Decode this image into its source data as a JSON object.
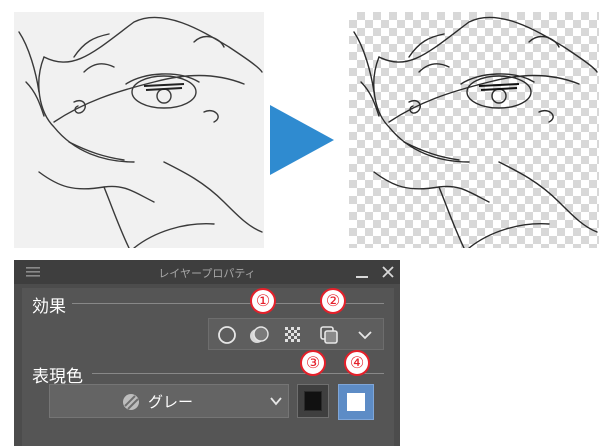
{
  "panel": {
    "title": "レイヤープロパティ",
    "menu_icon": "hamburger-menu-icon",
    "minimize_icon": "minimize-icon",
    "close_icon": "close-icon"
  },
  "effect": {
    "label": "効果",
    "buttons": [
      {
        "icon": "border-effect-icon"
      },
      {
        "icon": "extract-line-icon"
      },
      {
        "icon": "tone-icon"
      },
      {
        "icon": "layer-color-icon"
      },
      {
        "icon": "chevron-down-icon"
      }
    ]
  },
  "expression_color": {
    "label": "表現色",
    "selected": "グレー",
    "icon": "gray-sphere-icon",
    "swatches": [
      {
        "name": "black",
        "color": "#111111"
      },
      {
        "name": "white",
        "color": "#ffffff"
      }
    ]
  },
  "callouts": [
    "①",
    "②",
    "③",
    "④"
  ],
  "colors": {
    "accent_blue": "#2f8bd0",
    "callout_red": "#e4202a",
    "selected_blue": "#5d8cc6"
  },
  "images": {
    "before": "pencil-sketch-on-paper",
    "after": "line-art-on-transparent-background"
  }
}
